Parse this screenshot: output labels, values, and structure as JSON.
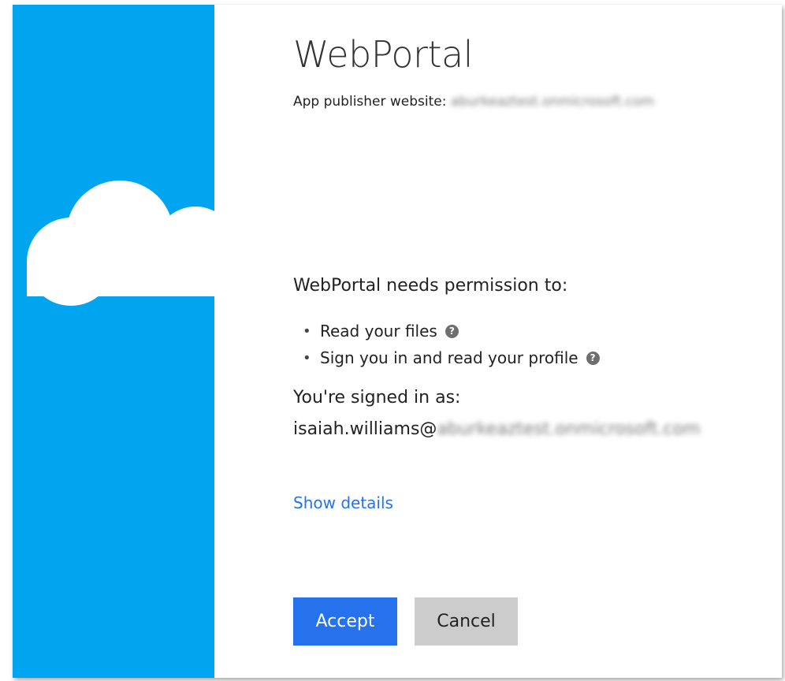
{
  "app": {
    "name": "WebPortal",
    "publisher_label": "App publisher website:",
    "publisher_value": "aburkeaztest.onmicrosoft.com"
  },
  "permissions": {
    "heading": "WebPortal needs permission to:",
    "items": [
      {
        "label": "Read your files",
        "icon": "help-icon"
      },
      {
        "label": "Sign you in and read your profile",
        "icon": "help-icon"
      }
    ]
  },
  "account": {
    "signed_in_label": "You're signed in as:",
    "user_prefix": "isaiah.williams@",
    "user_domain": "aburkeaztest.onmicrosoft.com"
  },
  "links": {
    "show_details": "Show details"
  },
  "buttons": {
    "accept": "Accept",
    "cancel": "Cancel"
  },
  "icons": {
    "help_glyph": "?",
    "bullet_glyph": "•"
  },
  "colors": {
    "side_panel": "#00a4ef",
    "accent": "#2672ec",
    "cancel_bg": "#cccccc"
  }
}
